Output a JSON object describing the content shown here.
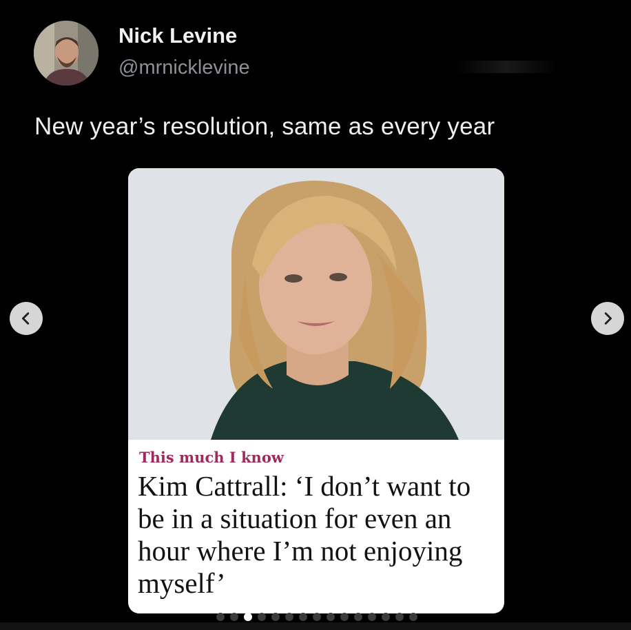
{
  "author": {
    "name": "Nick Levine",
    "handle": "@mrnicklevine"
  },
  "tweet": {
    "text": "New year’s resolution, same as every year"
  },
  "card": {
    "kicker": "This much I know",
    "headline": "Kim Cattrall: ‘I don’t want to be in a situation for even an hour where I’m not enjoying myself’"
  },
  "carousel": {
    "total_slides": 15,
    "active_index": 2,
    "prev_icon": "chevron-left-icon",
    "next_icon": "chevron-right-icon"
  },
  "colors": {
    "background": "#000000",
    "kicker": "#a12a5d",
    "handle": "#8d9197"
  }
}
